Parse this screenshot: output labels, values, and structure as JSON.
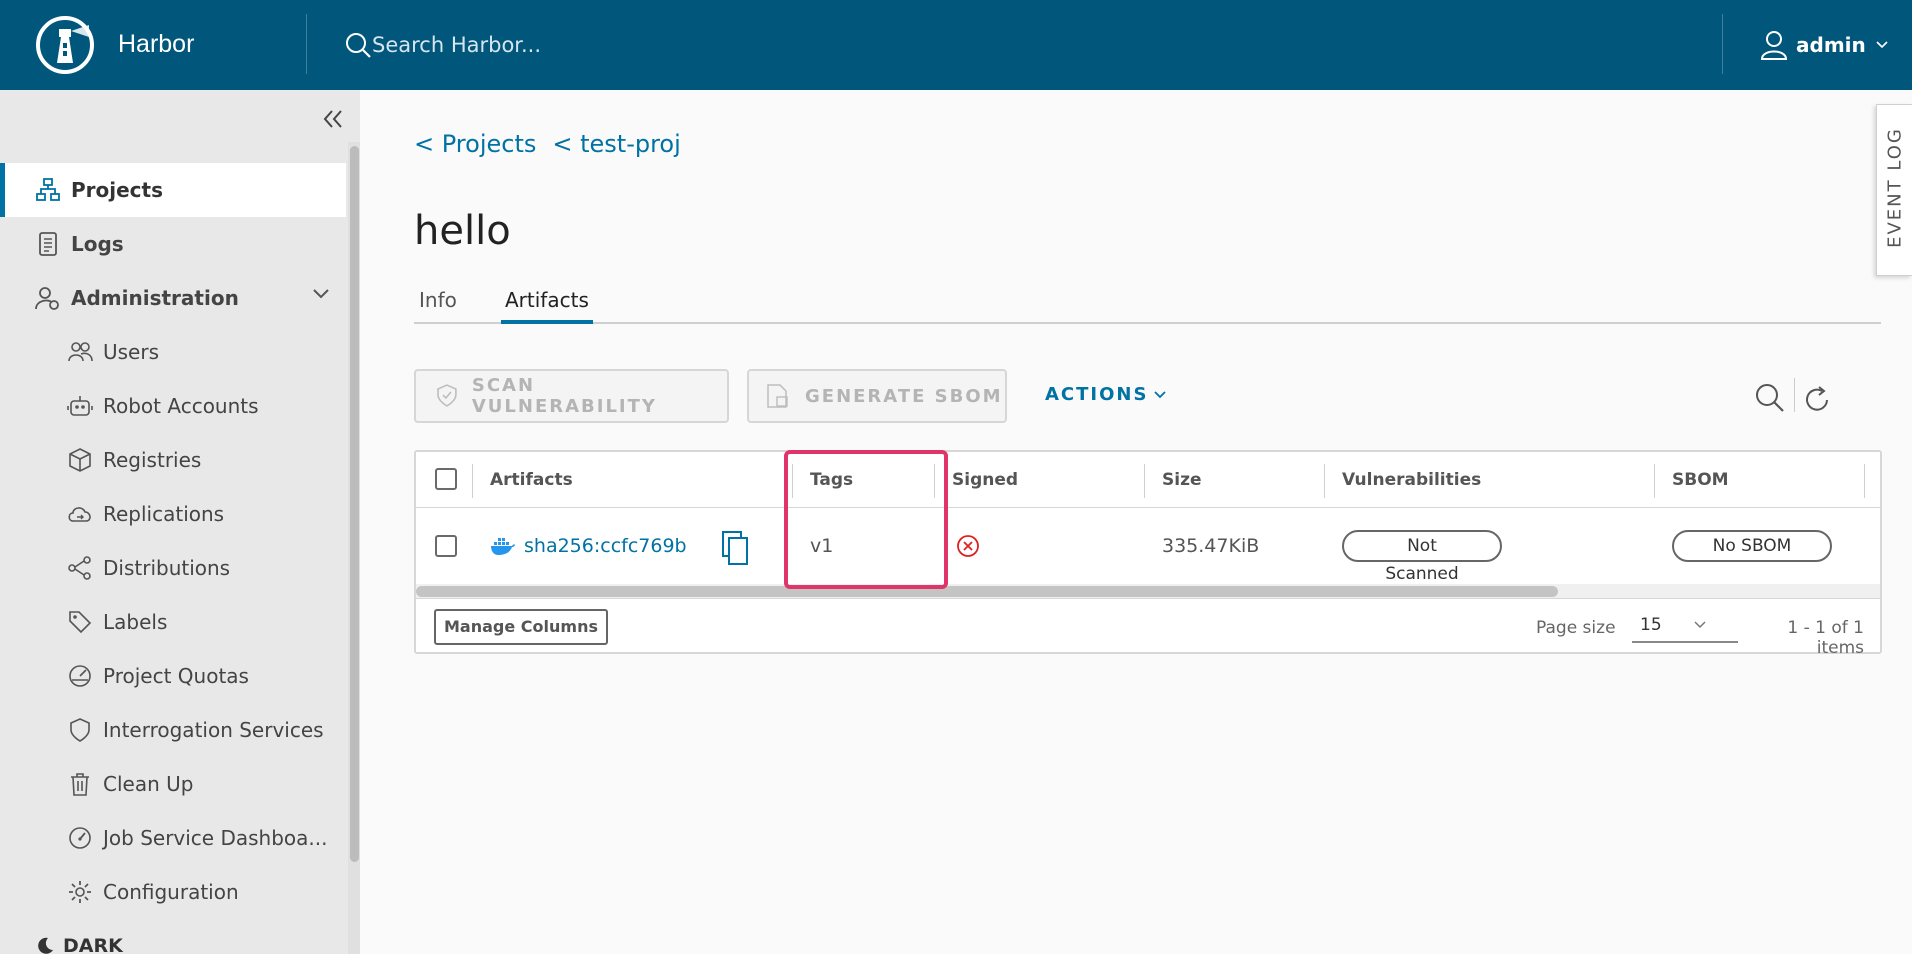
{
  "header": {
    "brand": "Harbor",
    "search_placeholder": "Search Harbor...",
    "user_name": "admin"
  },
  "sidebar": {
    "items": [
      {
        "label": "Projects",
        "icon": "projects-icon",
        "active": true
      },
      {
        "label": "Logs",
        "icon": "logs-icon"
      },
      {
        "label": "Administration",
        "icon": "administration-icon",
        "expanded": true
      },
      {
        "label": "Users",
        "icon": "users-icon"
      },
      {
        "label": "Robot Accounts",
        "icon": "robot-icon"
      },
      {
        "label": "Registries",
        "icon": "registries-icon"
      },
      {
        "label": "Replications",
        "icon": "replications-icon"
      },
      {
        "label": "Distributions",
        "icon": "distributions-icon"
      },
      {
        "label": "Labels",
        "icon": "labels-icon"
      },
      {
        "label": "Project Quotas",
        "icon": "quotas-icon"
      },
      {
        "label": "Interrogation Services",
        "icon": "interrogation-icon"
      },
      {
        "label": "Clean Up",
        "icon": "trash-icon"
      },
      {
        "label": "Job Service Dashboa...",
        "icon": "dashboard-icon"
      },
      {
        "label": "Configuration",
        "icon": "gear-icon"
      }
    ],
    "theme_toggle": "DARK"
  },
  "breadcrumb": {
    "projects": "< Projects",
    "project": "< test-proj"
  },
  "page_title": "hello",
  "tabs": [
    "Info",
    "Artifacts"
  ],
  "toolbar": {
    "scan": "SCAN VULNERABILITY",
    "sbom": "GENERATE SBOM",
    "actions": "ACTIONS"
  },
  "grid": {
    "columns": [
      "Artifacts",
      "Tags",
      "Signed",
      "Size",
      "Vulnerabilities",
      "SBOM"
    ],
    "rows": [
      {
        "artifact": "sha256:ccfc769b",
        "tags": "v1",
        "signed": false,
        "size": "335.47KiB",
        "vulnerabilities": "Not Scanned",
        "sbom": "No SBOM"
      }
    ],
    "manage_columns": "Manage Columns",
    "page_size_label": "Page size",
    "page_size": "15",
    "count": "1 - 1 of 1 items"
  },
  "event_log": "EVENT LOG",
  "colors": {
    "header": "#00567b",
    "accent": "#0072a3",
    "highlight": "#e0356a",
    "error": "#e02020"
  }
}
